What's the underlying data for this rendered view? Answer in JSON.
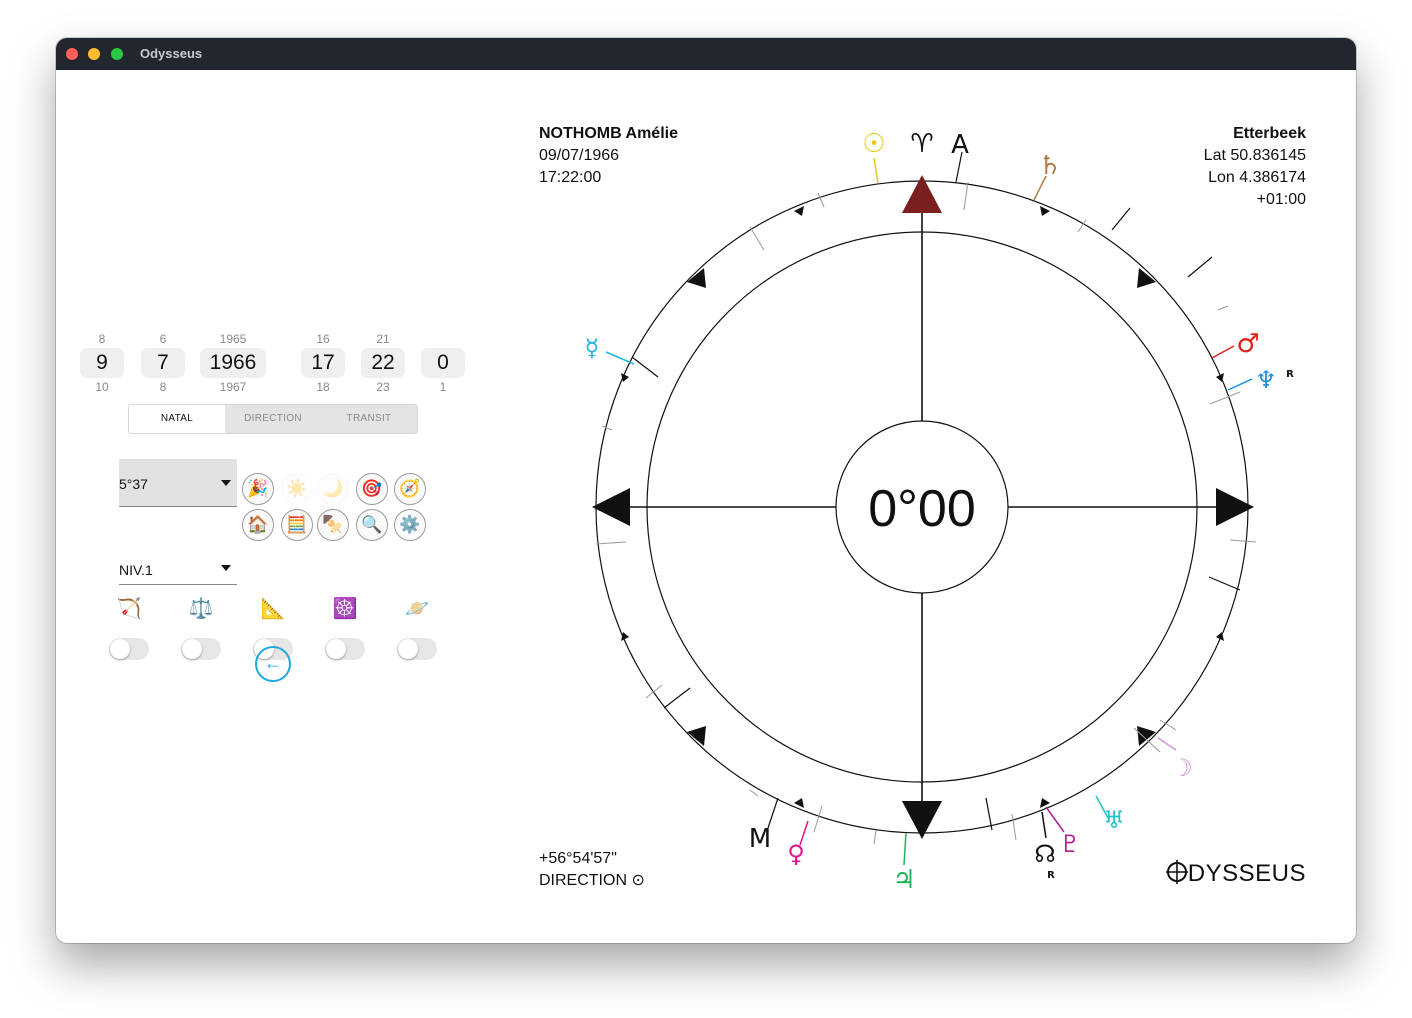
{
  "window": {
    "title": "Odysseus"
  },
  "pickers": [
    {
      "above": "8",
      "value": "9",
      "below": "10"
    },
    {
      "above": "6",
      "value": "7",
      "below": "8"
    },
    {
      "above": "1965",
      "value": "1966",
      "below": "1967"
    },
    {
      "above": "16",
      "value": "17",
      "below": "18"
    },
    {
      "above": "21",
      "value": "22",
      "below": "23"
    },
    {
      "above": "",
      "value": "0",
      "below": "1"
    }
  ],
  "modes": [
    "NATAL",
    "DIRECTION",
    "TRANSIT"
  ],
  "active_mode": "NATAL",
  "selects": {
    "orb": "5°37",
    "level": "NIV.1"
  },
  "icon_buttons": [
    "🎉",
    "☀️",
    "🌙",
    "🎯",
    "🧭",
    "🏠",
    "🧮",
    "🍢",
    "🔍",
    "⚙️"
  ],
  "toggle_icons": [
    "🏹",
    "⚖️",
    "📐",
    "☸️",
    "🪐"
  ],
  "toggles": [
    false,
    false,
    false,
    false,
    false
  ],
  "back_icon": "←",
  "chart": {
    "name": "NOTHOMB Amélie",
    "date": "09/07/1966",
    "time": "17:22:00",
    "place": "Etterbeek",
    "lat": "Lat 50.836145",
    "lon": "Lon 4.386174",
    "tz": "+01:00",
    "center": "0°00",
    "angle": "+56°54'57\"",
    "mode_label": "DIRECTION ⊙",
    "brand": "DYSSEUS",
    "aries": "♈",
    "asc": "A",
    "mc": "M",
    "retro": "R",
    "planets": [
      {
        "name": "Sun",
        "glyph": "☉",
        "color": "#e8c81a"
      },
      {
        "name": "Saturn",
        "glyph": "♄",
        "color": "#b07a42"
      },
      {
        "name": "Mars",
        "glyph": "♂",
        "color": "#e0201b"
      },
      {
        "name": "Neptune",
        "glyph": "♆",
        "color": "#1f8fe0"
      },
      {
        "name": "Moon",
        "glyph": "☽",
        "color": "#d78ee0"
      },
      {
        "name": "Uranus",
        "glyph": "♅",
        "color": "#22c2c8"
      },
      {
        "name": "Pluto",
        "glyph": "♇",
        "color": "#b1208d"
      },
      {
        "name": "Node",
        "glyph": "☊",
        "color": "#111111"
      },
      {
        "name": "Jupiter",
        "glyph": "♃",
        "color": "#22b35a"
      },
      {
        "name": "Venus",
        "glyph": "♀",
        "color": "#e0148c"
      },
      {
        "name": "Mercury",
        "glyph": "☿",
        "color": "#1fb5e0"
      }
    ]
  }
}
